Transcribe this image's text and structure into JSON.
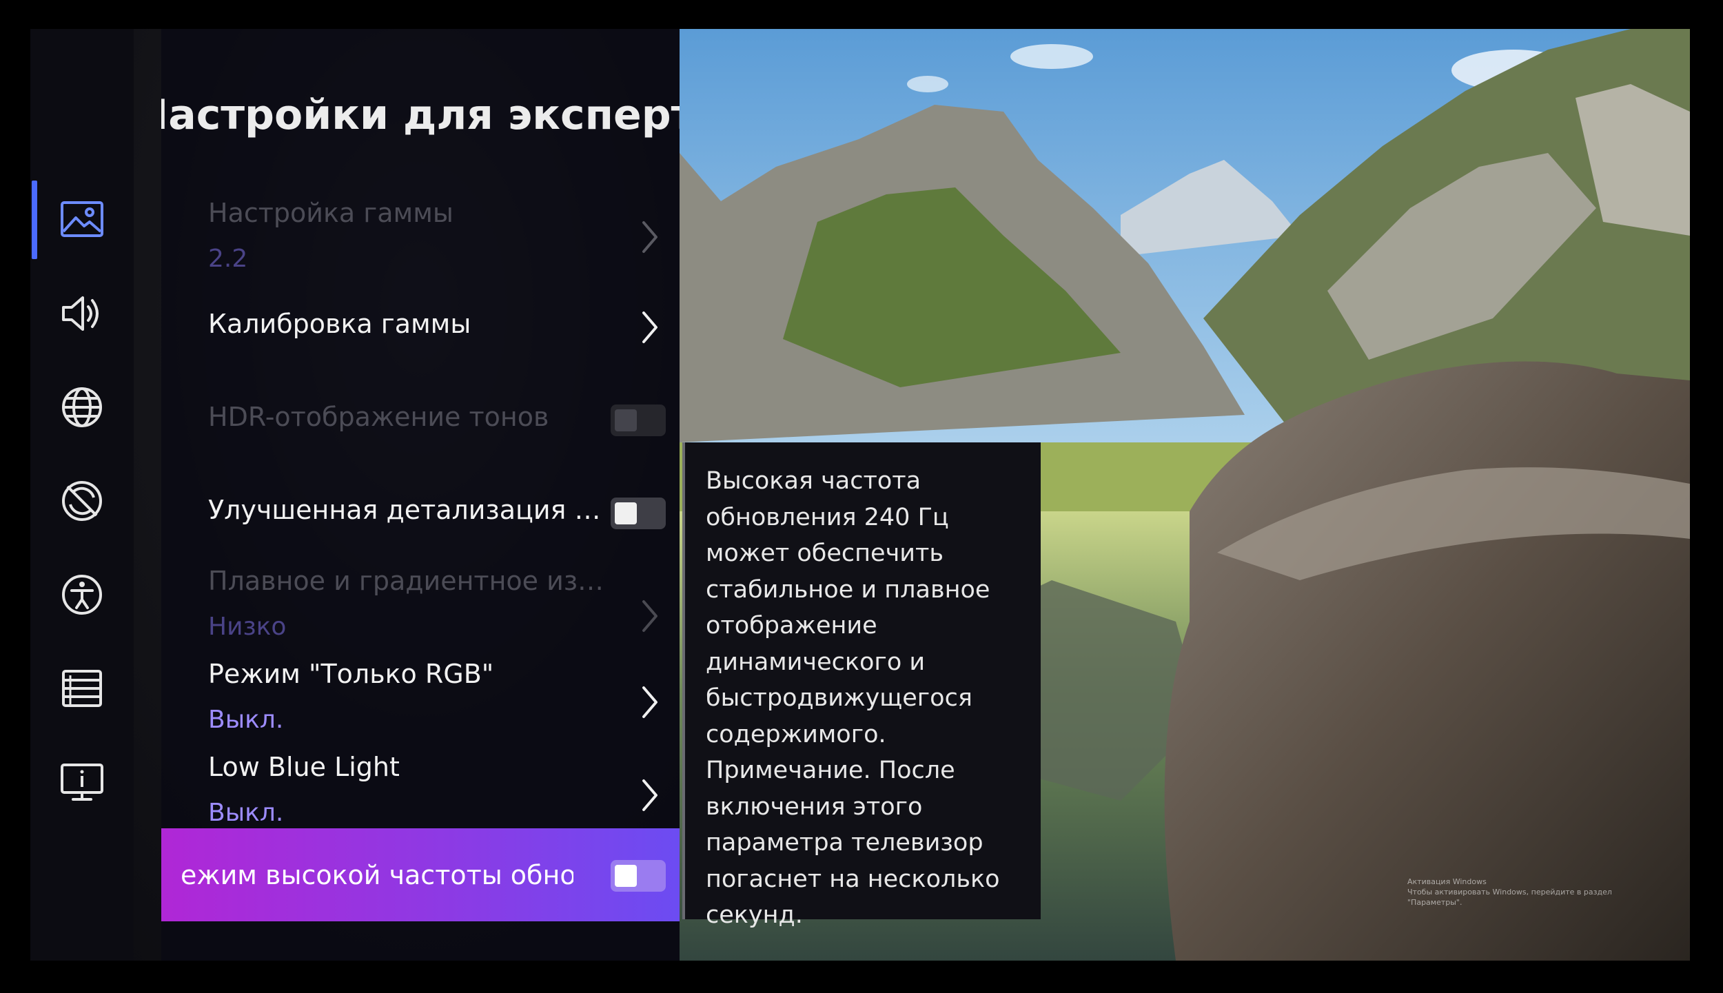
{
  "sidebar": {
    "items": [
      {
        "icon": "picture-icon",
        "active": true
      },
      {
        "icon": "sound-icon",
        "active": false
      },
      {
        "icon": "globe-icon",
        "active": false
      },
      {
        "icon": "disabled-target-icon",
        "active": false
      },
      {
        "icon": "accessibility-icon",
        "active": false
      },
      {
        "icon": "list-icon",
        "active": false
      },
      {
        "icon": "info-tv-icon",
        "active": false
      }
    ]
  },
  "panel": {
    "title": "Настройки для экспертов",
    "items": [
      {
        "label": "Настройка гаммы",
        "value": "2.2",
        "control": "chevron",
        "state": "disabled"
      },
      {
        "label": "Калибровка гаммы",
        "control": "chevron",
        "state": "enabled"
      },
      {
        "label": "HDR-отображение тонов",
        "control": "toggle",
        "state": "disabled"
      },
      {
        "label": "Улучшенная детализация те...",
        "control": "toggle",
        "state": "enabled"
      },
      {
        "label": "Плавное и градиентное изо...",
        "value": "Низко",
        "control": "chevron",
        "state": "disabled"
      },
      {
        "label": "Режим \"Только RGB\"",
        "value": "Выкл.",
        "control": "chevron",
        "state": "enabled"
      },
      {
        "label": "Low Blue Light",
        "value": "Выкл.",
        "control": "chevron",
        "state": "enabled"
      },
      {
        "label": "ежим высокой частоты обновле",
        "control": "toggle",
        "state": "focused"
      }
    ]
  },
  "tooltip": {
    "text": "Высокая частота обновления 240 Гц может обеспечить стабильное и плавное отображение динамического и быстродвижущегося содержимого. Примечание. После включения этого параметра телевизор погаснет на несколько секунд."
  },
  "watermark": {
    "line1": "Активация Windows",
    "line2": "Чтобы активировать Windows, перейдите в раздел \"Параметры\"."
  },
  "colors": {
    "accent_value": "#9d8cff",
    "active_bar": "#4b6bff",
    "focus_gradient_start": "#b027d6",
    "focus_gradient_end": "#6c4cf2"
  }
}
